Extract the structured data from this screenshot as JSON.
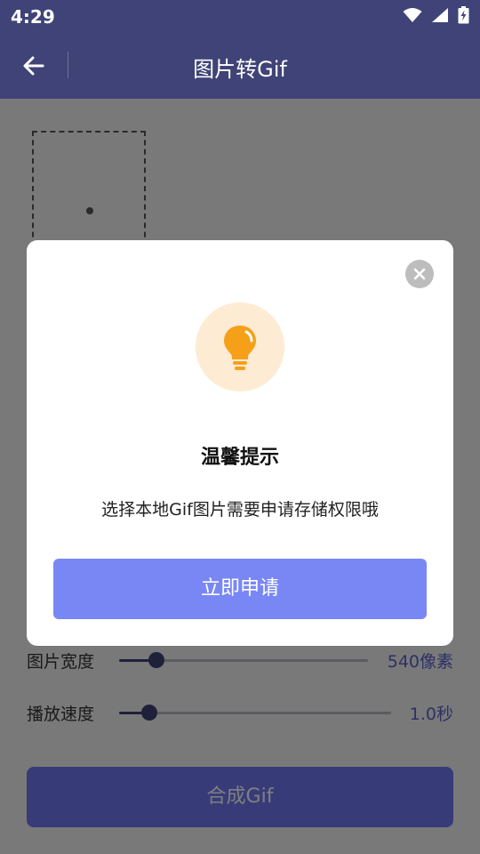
{
  "status_bar": {
    "time": "4:29",
    "icons": [
      "wifi-icon",
      "signal-icon",
      "battery-charging-icon"
    ]
  },
  "app_bar": {
    "title": "图片转Gif",
    "back_icon": "arrow-left-icon"
  },
  "main": {
    "settings": [
      {
        "label": "图片宽度",
        "value": "540像素",
        "level": 0.15
      },
      {
        "label": "播放速度",
        "value": "1.0秒",
        "level": 0.11
      }
    ],
    "compose_button": "合成Gif"
  },
  "dialog": {
    "icon": "lightbulb-icon",
    "title": "温馨提示",
    "message": "选择本地Gif图片需要申请存储权限哦",
    "confirm_button": "立即申请",
    "close_icon": "close-icon"
  },
  "colors": {
    "primary": "#3f4377",
    "accent_button": "#7987f5",
    "bulb": "#f6a01a",
    "bulb_background": "#fdebd3"
  }
}
